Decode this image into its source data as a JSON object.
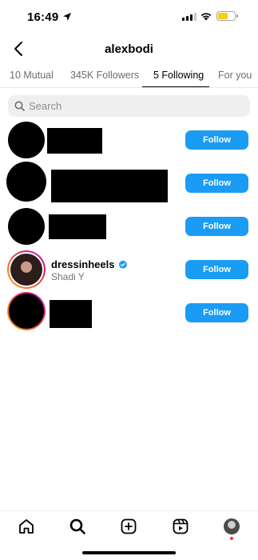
{
  "status_bar": {
    "time": "16:49",
    "location_icon": "location-arrow-icon",
    "signal_icon": "cellular-signal-icon",
    "wifi_icon": "wifi-icon",
    "battery_icon": "battery-icon",
    "battery_color": "#f5cf19",
    "battery_level": 0.62
  },
  "header": {
    "title": "alexbodi",
    "back_icon": "chevron-left-icon"
  },
  "tabs": [
    {
      "label": "10 Mutual",
      "active": false
    },
    {
      "label": "345K Followers",
      "active": false
    },
    {
      "label": "5 Following",
      "active": true
    },
    {
      "label": "For you",
      "active": false
    }
  ],
  "search": {
    "placeholder": "Search",
    "value": "",
    "icon": "search-icon"
  },
  "following": [
    {
      "username": "",
      "subtitle": "",
      "redacted": true,
      "has_story_ring": false,
      "button_label": "Follow"
    },
    {
      "username": "",
      "subtitle": "",
      "redacted": true,
      "has_story_ring": false,
      "button_label": "Follow"
    },
    {
      "username": "",
      "subtitle": "",
      "redacted": true,
      "has_story_ring": false,
      "button_label": "Follow"
    },
    {
      "username": "dressinheels",
      "subtitle": "Shadi Y",
      "redacted": false,
      "verified": true,
      "has_story_ring": true,
      "button_label": "Follow"
    },
    {
      "username": "",
      "subtitle": "",
      "redacted": true,
      "has_story_ring": true,
      "button_label": "Follow"
    }
  ],
  "colors": {
    "follow_button": "#1a9cf4",
    "verified_badge": "#1a9cf4",
    "notification_dot": "#ff3040"
  },
  "bottom_nav": [
    {
      "name": "home-icon"
    },
    {
      "name": "search-icon"
    },
    {
      "name": "create-post-icon"
    },
    {
      "name": "reels-icon"
    },
    {
      "name": "profile-avatar-icon",
      "has_notification_dot": true
    }
  ]
}
